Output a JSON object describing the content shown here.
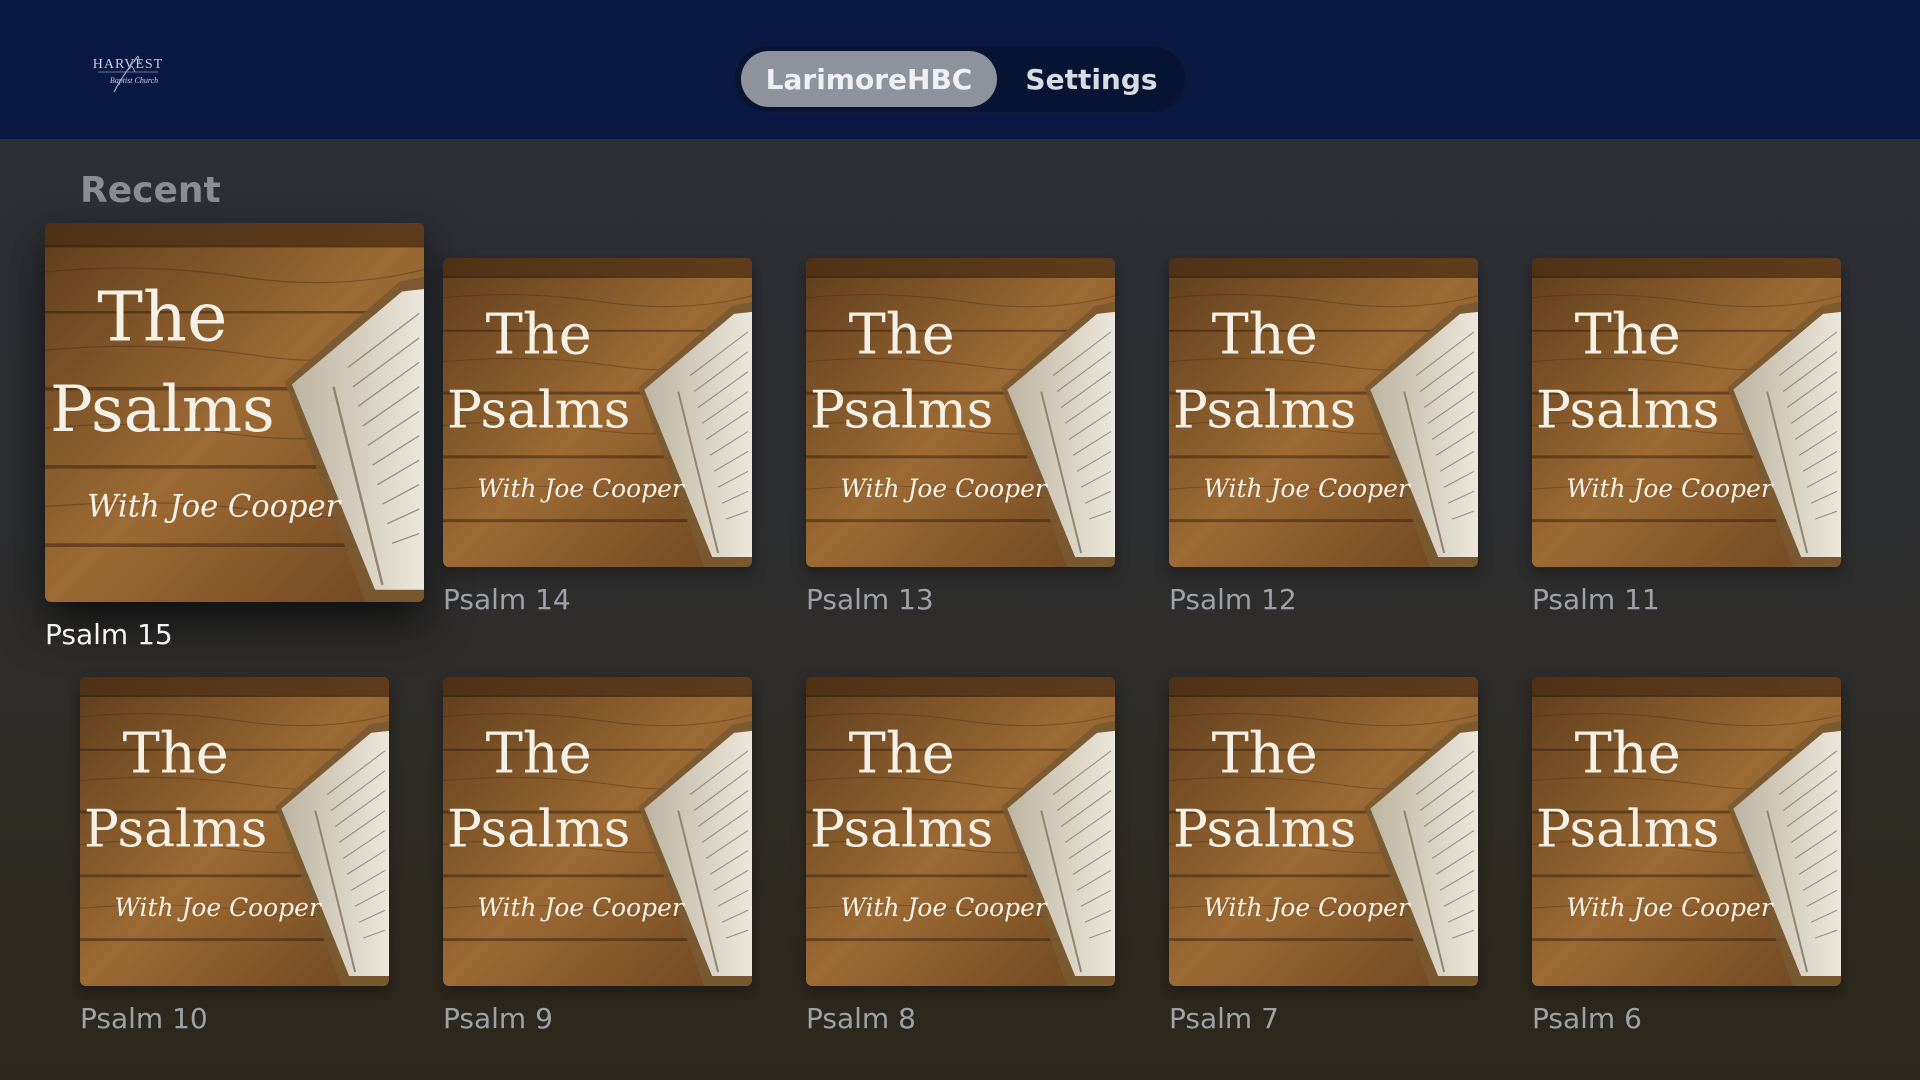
{
  "header": {
    "logo": {
      "line1": "HARVEST",
      "line2": "Baptist Church"
    },
    "tabs": [
      {
        "label": "LarimoreHBC",
        "active": true
      },
      {
        "label": "Settings",
        "active": false
      }
    ]
  },
  "recent": {
    "title": "Recent",
    "cover": {
      "line1": "The",
      "line2": "Psalms",
      "line3": "With Joe Cooper"
    },
    "items": [
      {
        "label": "Psalm 15",
        "focused": true
      },
      {
        "label": "Psalm 14"
      },
      {
        "label": "Psalm 13"
      },
      {
        "label": "Psalm 12"
      },
      {
        "label": "Psalm 11"
      },
      {
        "label": "Psalm 10"
      },
      {
        "label": "Psalm 9"
      },
      {
        "label": "Psalm 8"
      },
      {
        "label": "Psalm 7"
      },
      {
        "label": "Psalm 6"
      }
    ]
  },
  "colors": {
    "header_bg": "#0a1844",
    "tab_active_bg": "#8d929c",
    "label_text": "#9ea1a7",
    "focused_label_text": "#f4f4f4"
  }
}
